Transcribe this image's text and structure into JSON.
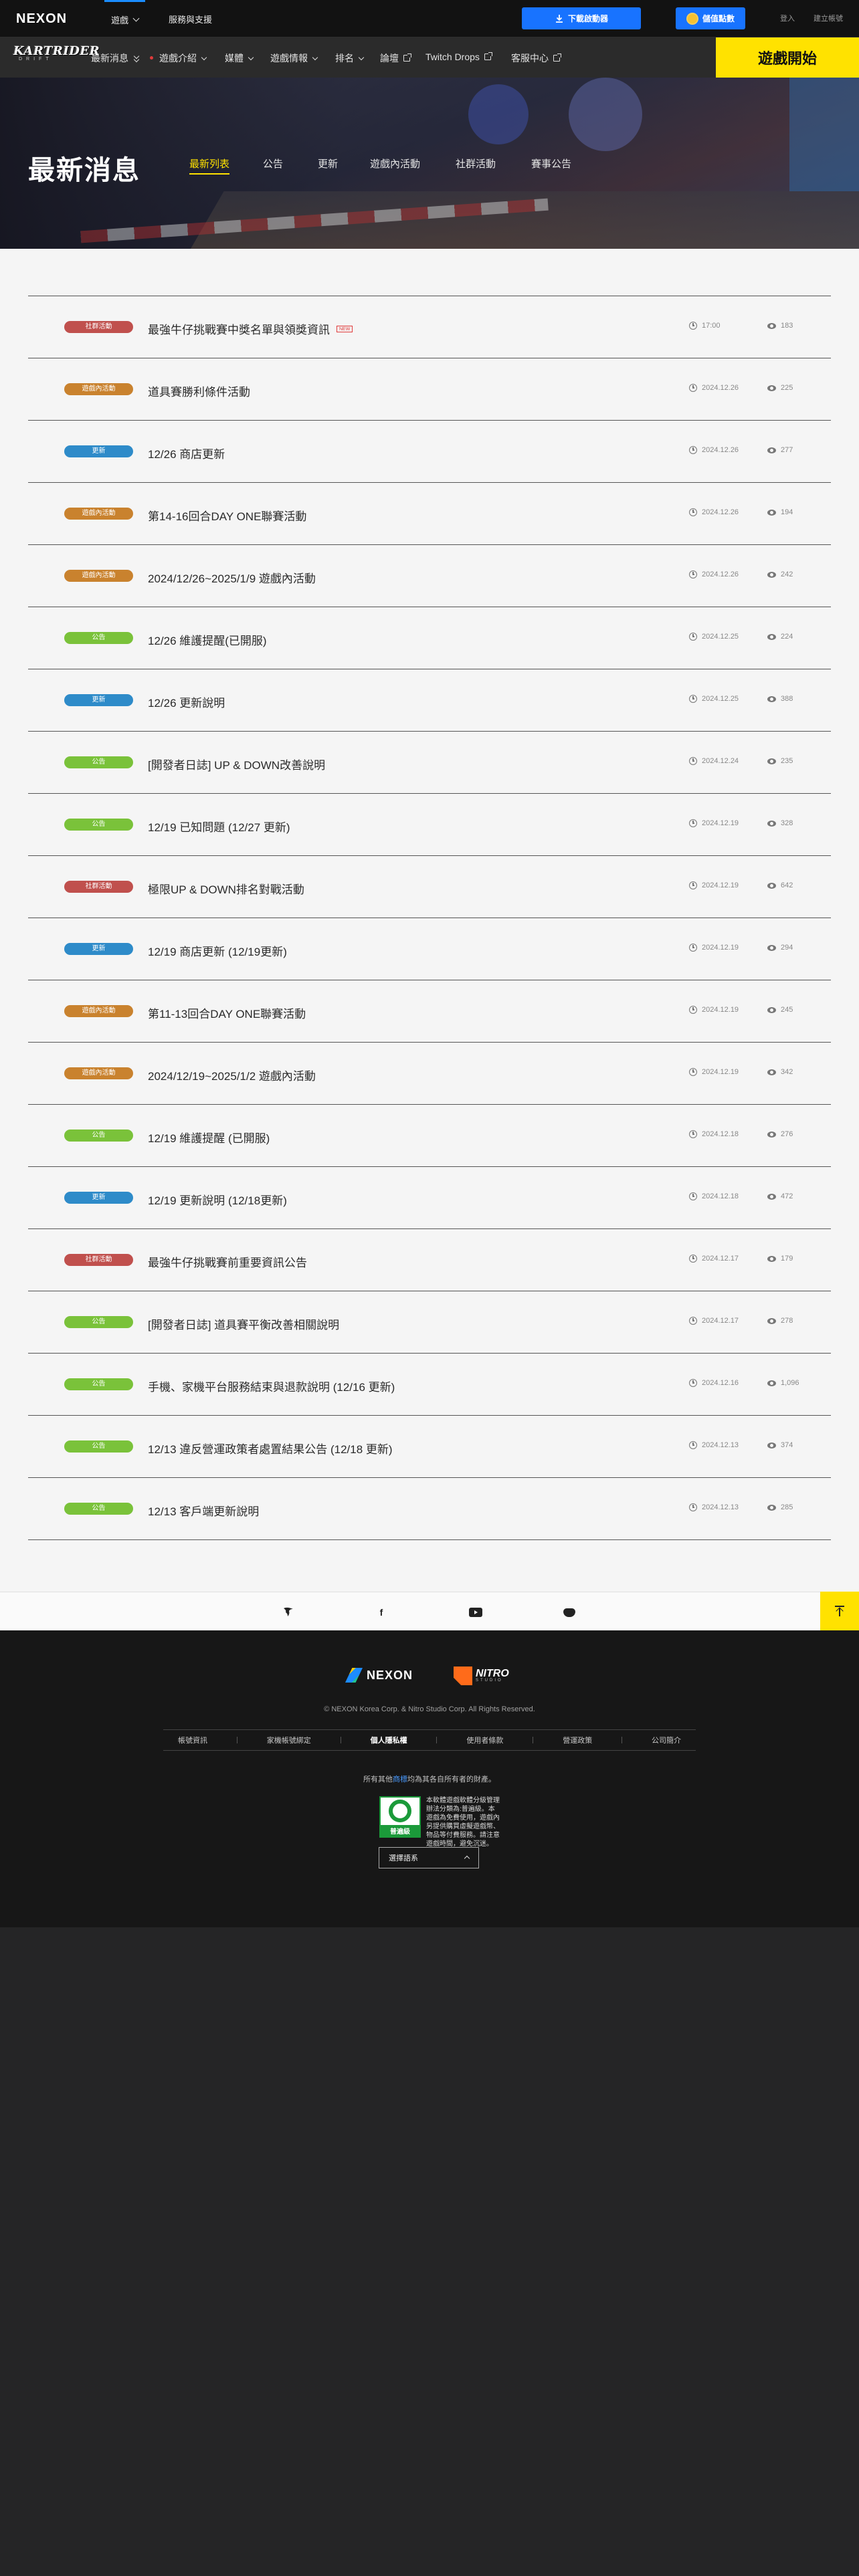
{
  "topbar": {
    "brand": "NEXON",
    "tabs": [
      {
        "label": "遊戲",
        "active": true
      },
      {
        "label": "服務與支援",
        "active": false
      }
    ],
    "download_label": "下載啟動器",
    "cash_label": "儲值點數",
    "login_label": "登入",
    "signup_label": "建立帳號"
  },
  "gamenav": {
    "logo_word": "KARTRIDER",
    "logo_sub": "DRIFT",
    "items": [
      {
        "label": "最新消息",
        "type": "dropdown-active"
      },
      {
        "label": "遊戲介紹",
        "type": "dropdown"
      },
      {
        "label": "媒體",
        "type": "dropdown"
      },
      {
        "label": "遊戲情報",
        "type": "dropdown"
      },
      {
        "label": "排名",
        "type": "dropdown"
      },
      {
        "label": "論壇",
        "type": "external"
      },
      {
        "label": "Twitch Drops",
        "type": "external"
      },
      {
        "label": "客服中心",
        "type": "external"
      }
    ],
    "play_label": "遊戲開始"
  },
  "hero": {
    "title": "最新消息",
    "tabs": [
      "最新列表",
      "公告",
      "更新",
      "遊戲內活動",
      "社群活動",
      "賽事公告"
    ],
    "active_tab": 0
  },
  "categories": {
    "社群活動": "#c0504d",
    "遊戲內活動": "#c9822e",
    "更新": "#2e8bc9",
    "公告": "#7ac23a"
  },
  "posts": [
    {
      "category": "社群活動",
      "title": "最強牛仔挑戰賽中獎名單與領獎資訊",
      "new": true,
      "new_label": "NEW",
      "date": "17:00",
      "views": "183"
    },
    {
      "category": "遊戲內活動",
      "title": "道具賽勝利條件活動",
      "new": false,
      "date": "2024.12.26",
      "views": "225"
    },
    {
      "category": "更新",
      "title": "12/26 商店更新",
      "new": false,
      "date": "2024.12.26",
      "views": "277"
    },
    {
      "category": "遊戲內活動",
      "title": "第14-16回合DAY ONE聯賽活動",
      "new": false,
      "date": "2024.12.26",
      "views": "194"
    },
    {
      "category": "遊戲內活動",
      "title": "2024/12/26~2025/1/9 遊戲內活動",
      "new": false,
      "date": "2024.12.26",
      "views": "242"
    },
    {
      "category": "公告",
      "title": "12/26 維護提醒(已開服)",
      "new": false,
      "date": "2024.12.25",
      "views": "224"
    },
    {
      "category": "更新",
      "title": "12/26 更新說明",
      "new": false,
      "date": "2024.12.25",
      "views": "388"
    },
    {
      "category": "公告",
      "title": "[開發者日誌] UP & DOWN改善說明",
      "new": false,
      "date": "2024.12.24",
      "views": "235"
    },
    {
      "category": "公告",
      "title": "12/19 已知問題 (12/27 更新)",
      "new": false,
      "date": "2024.12.19",
      "views": "328"
    },
    {
      "category": "社群活動",
      "title": "極限UP & DOWN排名對戰活動",
      "new": false,
      "date": "2024.12.19",
      "views": "642"
    },
    {
      "category": "更新",
      "title": "12/19 商店更新 (12/19更新)",
      "new": false,
      "date": "2024.12.19",
      "views": "294"
    },
    {
      "category": "遊戲內活動",
      "title": "第11-13回合DAY ONE聯賽活動",
      "new": false,
      "date": "2024.12.19",
      "views": "245"
    },
    {
      "category": "遊戲內活動",
      "title": "2024/12/19~2025/1/2 遊戲內活動",
      "new": false,
      "date": "2024.12.19",
      "views": "342"
    },
    {
      "category": "公告",
      "title": "12/19 維護提醒 (已開服)",
      "new": false,
      "date": "2024.12.18",
      "views": "276"
    },
    {
      "category": "更新",
      "title": "12/19 更新說明 (12/18更新)",
      "new": false,
      "date": "2024.12.18",
      "views": "472"
    },
    {
      "category": "社群活動",
      "title": "最強牛仔挑戰賽前重要資訊公告",
      "new": false,
      "date": "2024.12.17",
      "views": "179"
    },
    {
      "category": "公告",
      "title": "[開發者日誌] 道具賽平衡改善相關說明",
      "new": false,
      "date": "2024.12.17",
      "views": "278"
    },
    {
      "category": "公告",
      "title": "手機、家機平台服務結束與退款說明 (12/16 更新)",
      "new": false,
      "date": "2024.12.16",
      "views": "1,096"
    },
    {
      "category": "公告",
      "title": "12/13 違反營運政策者處置結果公告 (12/18 更新)",
      "new": false,
      "date": "2024.12.13",
      "views": "374"
    },
    {
      "category": "公告",
      "title": "12/13 客戶端更新說明",
      "new": false,
      "date": "2024.12.13",
      "views": "285"
    }
  ],
  "social": {
    "icons": [
      "twitch-icon",
      "facebook-icon",
      "youtube-icon",
      "discord-icon"
    ],
    "facebook_glyph": "f"
  },
  "footer": {
    "nexon_label": "NEXON",
    "nitro_label": "NITRO",
    "nitro_sub": "STUDIO",
    "copyright": "© NEXON Korea Corp. & Nitro Studio Corp. All Rights Reserved.",
    "links": [
      "帳號資訊",
      "家機帳號綁定",
      "個人隱私權",
      "使用者條款",
      "營運政策",
      "公司簡介"
    ],
    "bold_link_index": 2,
    "note_prefix": "所有其他",
    "note_highlight": "商標",
    "note_suffix": "均為其各自所有者的財產。",
    "rating_label": "普遍級",
    "rating_text": "本軟體遊戲軟體分級管理辦法分類為:普遍級。本遊戲為免費使用，遊戲內另提供購買虛擬遊戲幣、物品等付費服務。請注意遊戲時間，避免沉迷。",
    "language_label": "選擇語系"
  }
}
